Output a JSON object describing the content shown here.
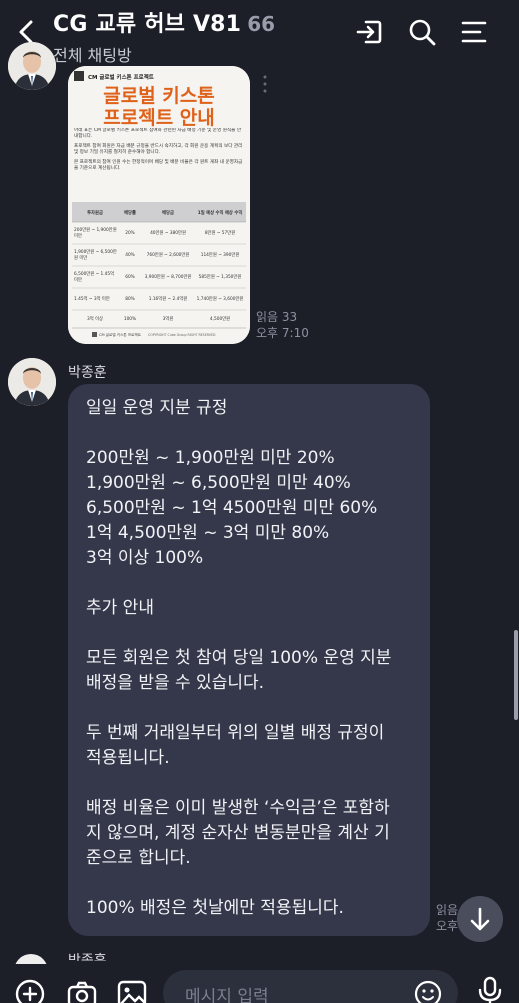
{
  "header": {
    "title": "CG 교류 허브 V81",
    "member_count": "66",
    "subtitle": "전체 채팅방"
  },
  "image_message": {
    "brand_text": "CM 글로벌 키스톤 프로젝트",
    "heading_line1": "글로벌 키스톤",
    "heading_line2": "프로젝트 안내",
    "paragraphs": [
      "아래 표는 CM 글로벌 키스톤 프로젝트 참여와 관련된 자금 배정 기준 및 운영 원칙을 안내합니다.",
      "프로젝트 참여 회원은 자금 배분 규정을 반드시 숙지하고, 각 회원 운용 계획의 보다 관리 및 정보 기밀 유지를 철저히 준수해야 합니다.",
      "본 프로젝트의 참여 인원 수는 한정적이며 배당 및 배분 비율은 각 원트 게좌 내 운영자금을 기준으로 계산됩니다."
    ],
    "table_headers": [
      "투자원금",
      "배당률",
      "배당금",
      "1일 예상 수익 예상 수익"
    ],
    "table_rows": [
      [
        "200만원 ~ 1,900만원 미만",
        "20%",
        "40만원 ~ 380만원",
        "8만원 ~ 57만원"
      ],
      [
        "1,900만원 ~ 6,500만원 미만",
        "40%",
        "760만원 ~ 2,600만원",
        "114만원 ~ 390만원"
      ],
      [
        "6,500만원 ~ 1.45억 미만",
        "60%",
        "3,900만원 ~ 8,700만원",
        "585만원 ~ 1,350만원"
      ],
      [
        "1.45억 ~ 3억 미만",
        "80%",
        "1.16억원 ~ 2.4억원",
        "1,740만원 ~ 3,600만원"
      ],
      [
        "3억 이상",
        "100%",
        "3억원",
        "4,500만원"
      ]
    ],
    "footer": "CM 글로벌 키스톤 프로젝트",
    "copyright": "COPYRIGHT Cube Group RIGHT RESERVED"
  },
  "message_meta_1": {
    "read": "읽음 33",
    "time": "오후 7:10"
  },
  "message_2": {
    "sender": "박종훈",
    "lines": [
      "일일 운영 지분 규정",
      "",
      "200만원 ~ 1,900만원 미만 20%",
      "1,900만원 ~ 6,500만원 미만 40%",
      "6,500만원 ~ 1억 4500만원 미만 60%",
      "1억 4,500만원 ~ 3억 미만 80%",
      "3억 이상 100%",
      "",
      "추가 안내",
      "",
      "모든 회원은 첫 참여 당일 100% 운영 지분",
      "배정을 받을 수 있습니다.",
      "",
      "두 번째 거래일부터 위의 일별 배정 규정이",
      "적용됩니다.",
      "",
      "배정 비율은 이미 발생한 ‘수익금’은 포함하",
      "지 않으며, 계정 순자산 변동분만을 계산 기",
      "준으로 합니다.",
      "",
      "100% 배정은 첫날에만 적용됩니다."
    ]
  },
  "message_meta_2": {
    "read": "읽음 33",
    "time": "오후 7:"
  },
  "next_sender": "박종훈",
  "input": {
    "placeholder": "메시지 입력"
  },
  "colors": {
    "background": "#1c1e28",
    "bubble": "#35384a",
    "input": "#2c2f3c",
    "heading_orange": "#e0621a"
  }
}
